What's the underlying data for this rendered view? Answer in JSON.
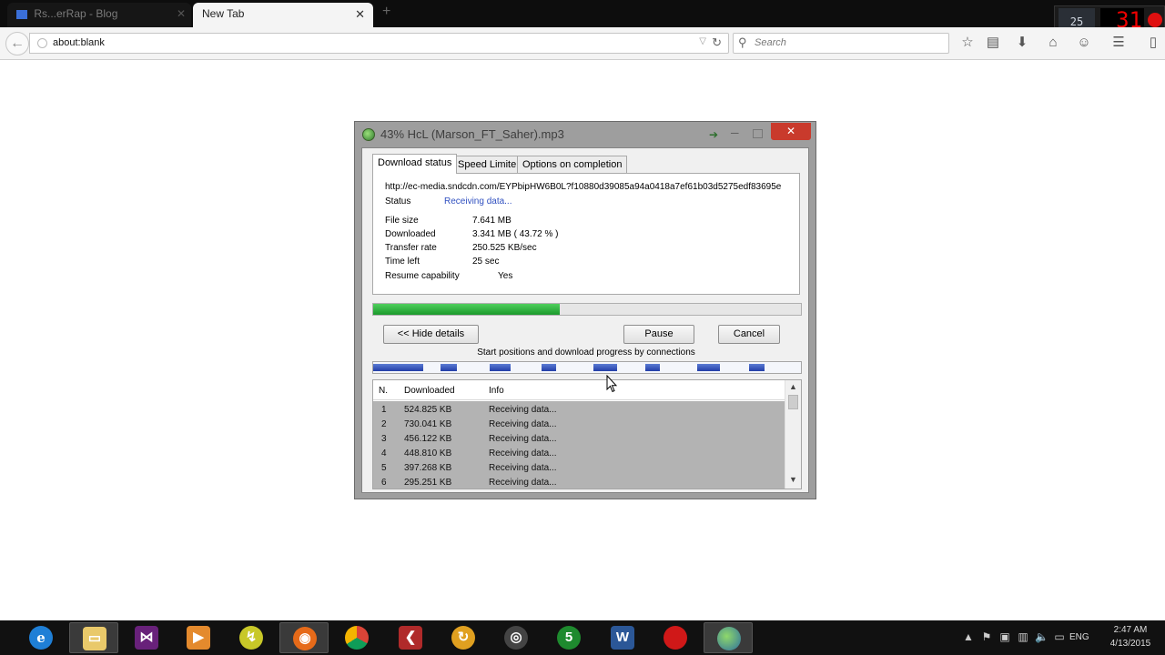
{
  "browser": {
    "tabs": [
      {
        "label": "Rs...erRap - Blog"
      },
      {
        "label": "New Tab"
      }
    ],
    "new_tab": "+",
    "url": "about:blank",
    "search_placeholder": "Search"
  },
  "recorder": {
    "fps": "25",
    "timer": "31"
  },
  "idm": {
    "title": "43% HcL (Marson_FT_Saher).mp3",
    "tabs": [
      "Download status",
      "Speed Limiter",
      "Options on completion"
    ],
    "url": "http://ec-media.sndcdn.com/EYPbipHW6B0L?f10880d39085a94a0418a7ef61b03d5275edf83695e",
    "status_label": "Status",
    "status_value": "Receiving data...",
    "file_size_label": "File size",
    "file_size_value": "7.641  MB",
    "downloaded_label": "Downloaded",
    "downloaded_value": "3.341  MB  ( 43.72 % )",
    "transfer_rate_label": "Transfer rate",
    "transfer_rate_value": "250.525  KB/sec",
    "time_left_label": "Time left",
    "time_left_value": "25 sec",
    "resume_label": "Resume capability",
    "resume_value": "Yes",
    "progress_fraction": 0.4372,
    "hide_details": "<< Hide details",
    "pause": "Pause",
    "cancel": "Cancel",
    "connections_caption": "Start positions and download progress by connections",
    "table_headers": {
      "n": "N.",
      "downloaded": "Downloaded",
      "info": "Info"
    },
    "connections": [
      {
        "n": "1",
        "downloaded": "524.825  KB",
        "info": "Receiving data..."
      },
      {
        "n": "2",
        "downloaded": "730.041  KB",
        "info": "Receiving data..."
      },
      {
        "n": "3",
        "downloaded": "456.122  KB",
        "info": "Receiving data..."
      },
      {
        "n": "4",
        "downloaded": "448.810  KB",
        "info": "Receiving data..."
      },
      {
        "n": "5",
        "downloaded": "397.268  KB",
        "info": "Receiving data..."
      },
      {
        "n": "6",
        "downloaded": "295.251  KB",
        "info": "Receiving data..."
      }
    ]
  },
  "taskbar": {
    "apps": [
      "internet-explorer",
      "file-explorer",
      "visual-studio",
      "media-player",
      "app-5",
      "firefox",
      "chrome",
      "app-8",
      "app-9",
      "app-10",
      "app-11",
      "word",
      "recorder",
      "download-manager"
    ],
    "lang": "ENG",
    "time": "2:47 AM",
    "date": "4/13/2015"
  }
}
